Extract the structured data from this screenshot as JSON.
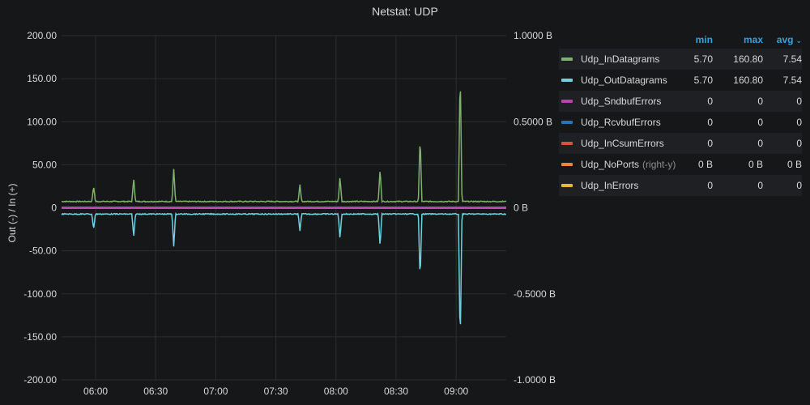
{
  "panel": {
    "title": "Netstat: UDP"
  },
  "chart_data": {
    "type": "line",
    "title": "Netstat: UDP",
    "ylabel": "Out (-) / In (+)",
    "ylim": [
      -200,
      200
    ],
    "y2lim": [
      -1,
      1
    ],
    "y_ticks": [
      "200.00",
      "150.00",
      "100.00",
      "50.00",
      "0",
      "-50.00",
      "-100.00",
      "-150.00",
      "-200.00"
    ],
    "y2_ticks": [
      "1.0000 B",
      "0.5000 B",
      "0 B",
      "-0.5000 B",
      "-1.0000 B"
    ],
    "x_ticks": [
      "06:00",
      "06:30",
      "07:00",
      "07:30",
      "08:00",
      "08:30",
      "09:00"
    ],
    "x_range": [
      "05:43",
      "09:25"
    ],
    "grid": true,
    "baseline": {
      "in": 7.3,
      "out": -7.3
    },
    "spikes": [
      {
        "time": "05:59",
        "value": 25
      },
      {
        "time": "06:19",
        "value": 34
      },
      {
        "time": "06:39",
        "value": 45
      },
      {
        "time": "07:42",
        "value": 27
      },
      {
        "time": "08:02",
        "value": 36
      },
      {
        "time": "08:22",
        "value": 46
      },
      {
        "time": "08:42",
        "value": 84
      },
      {
        "time": "09:02",
        "value": 160.8
      }
    ],
    "series": [
      {
        "name": "Udp_InDatagrams",
        "color": "#7eb26d",
        "min": "5.70",
        "max": "160.80",
        "avg": "7.54"
      },
      {
        "name": "Udp_OutDatagrams",
        "color": "#6ed0e0",
        "min": "5.70",
        "max": "160.80",
        "avg": "7.54"
      },
      {
        "name": "Udp_SndbufErrors",
        "color": "#ba43a9",
        "min": "0",
        "max": "0",
        "avg": "0"
      },
      {
        "name": "Udp_RcvbufErrors",
        "color": "#1f78c1",
        "min": "0",
        "max": "0",
        "avg": "0"
      },
      {
        "name": "Udp_InCsumErrors",
        "color": "#e24d42",
        "min": "0",
        "max": "0",
        "avg": "0"
      },
      {
        "name": "Udp_NoPorts",
        "note": "(right-y)",
        "color": "#ef843c",
        "min": "0 B",
        "max": "0 B",
        "avg": "0 B"
      },
      {
        "name": "Udp_InErrors",
        "color": "#eab839",
        "min": "0",
        "max": "0",
        "avg": "0"
      }
    ],
    "legend_position": "right"
  },
  "legend": {
    "min_label": "min",
    "max_label": "max",
    "avg_label": "avg",
    "sort_icon": "chevron-down-icon"
  }
}
